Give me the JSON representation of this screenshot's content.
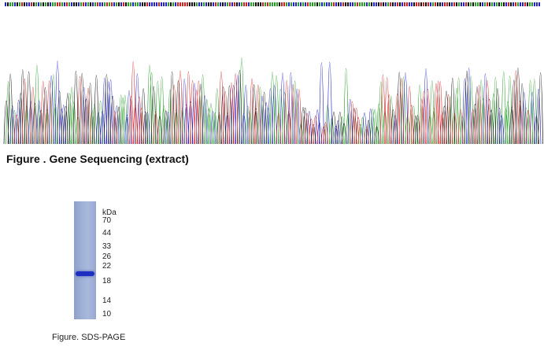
{
  "sequencing": {
    "title": "Figure . Gene Sequencing (extract)",
    "colors": {
      "A": "#2aa02a",
      "C": "#2424c8",
      "G": "#111111",
      "T": "#d02020"
    }
  },
  "gel": {
    "unit_label": "kDa",
    "markers": [
      "70",
      "44",
      "33",
      "26",
      "22",
      "18",
      "14",
      "10"
    ],
    "band_color": "#1e2fc0",
    "lane_color": "#9fb0d6",
    "caption": "Figure. SDS-PAGE"
  }
}
